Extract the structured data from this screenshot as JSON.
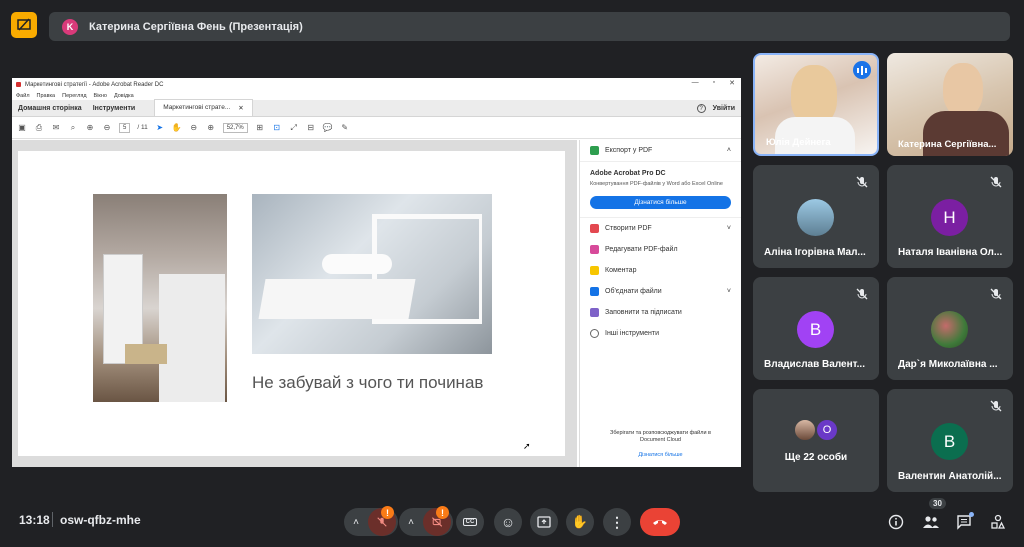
{
  "meeting": {
    "presenter_initial": "K",
    "presenter_title": "Катерина Сергіївна Фень (Презентація)",
    "time": "13:18",
    "code": "osw-qfbz-mhe",
    "participants_count": "30"
  },
  "acrobat": {
    "window_title": "Маркетингові стратегії - Adobe Acrobat Reader DC",
    "menu": [
      "Файл",
      "Правка",
      "Перегляд",
      "Вікно",
      "Довідка"
    ],
    "tab_home": "Домашня сторінка",
    "tab_tools": "Інструменти",
    "tab_doc": "Маркетингові страте...",
    "sign_in": "Увійти",
    "page_current": "5",
    "page_total": "/ 11",
    "zoom": "52,7%",
    "slide_text": "Не забувай з чого ти починав",
    "panel": {
      "export": "Експорт у PDF",
      "promo_title": "Adobe Acrobat Pro DC",
      "promo_text": "Конвертування PDF-файлів у Word або Excel Online",
      "promo_button": "Дізнатися більше",
      "items": [
        "Створити PDF",
        "Редагувати PDF-файл",
        "Коментар",
        "Об'єднати файли",
        "Заповнити та підписати",
        "Інші інструменти"
      ],
      "footer": "Зберігати та розповсюджувати файли в Document Cloud",
      "footer_link": "Дізнатися більше"
    }
  },
  "tiles": [
    {
      "name": "Юлія Дейнега",
      "type": "video"
    },
    {
      "name": "Катерина Сергіївна...",
      "type": "video"
    },
    {
      "name": "Аліна Ігорівна Мал...",
      "type": "photo"
    },
    {
      "name": "Наталя Іванівна Ол...",
      "initial": "Н",
      "color": "#7b1fa2"
    },
    {
      "name": "Владислав Валент...",
      "initial": "В",
      "color": "#a142f4"
    },
    {
      "name": "Дар`я Миколаївна ...",
      "type": "photo"
    },
    {
      "name": "Ще 22 особи",
      "extra_initial": "О"
    },
    {
      "name": "Валентин Анатолій...",
      "initial": "В",
      "color": "#0b6e4f"
    }
  ]
}
